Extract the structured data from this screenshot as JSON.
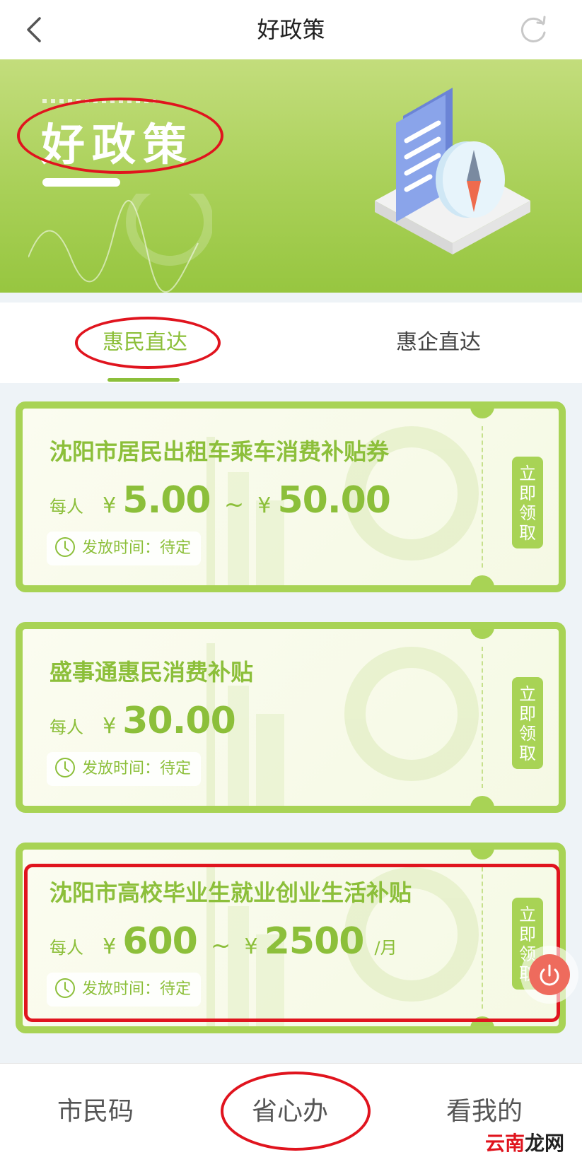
{
  "header": {
    "title": "好政策"
  },
  "banner": {
    "title": "好政策"
  },
  "tabs": [
    {
      "label": "惠民直达",
      "active": true
    },
    {
      "label": "惠企直达",
      "active": false
    }
  ],
  "cards": [
    {
      "title": "沈阳市居民出租车乘车消费补贴券",
      "per_person": "每人",
      "currency": "¥",
      "amount_min": "5.00",
      "tilde": "~",
      "amount_max": "50.00",
      "unit": "",
      "time_label": "发放时间：待定",
      "button": [
        "立",
        "即",
        "领",
        "取"
      ]
    },
    {
      "title": "盛事通惠民消费补贴",
      "per_person": "每人",
      "currency": "¥",
      "amount_min": "30.00",
      "time_label": "发放时间：待定",
      "button": [
        "立",
        "即",
        "领",
        "取"
      ]
    },
    {
      "title": "沈阳市高校毕业生就业创业生活补贴",
      "per_person": "每人",
      "currency": "¥",
      "amount_min": "600",
      "tilde": "~",
      "amount_max": "2500",
      "unit": "/月",
      "time_label": "发放时间：待定",
      "button": [
        "立",
        "即",
        "领",
        "取"
      ]
    }
  ],
  "bottom_nav": [
    "市民码",
    "省心办",
    "看我的"
  ],
  "watermark": {
    "part1": "云南",
    "part2": "龙网"
  },
  "colors": {
    "accent": "#8cbf3a",
    "card_border": "#a8d355",
    "annotation": "#e0141e"
  }
}
